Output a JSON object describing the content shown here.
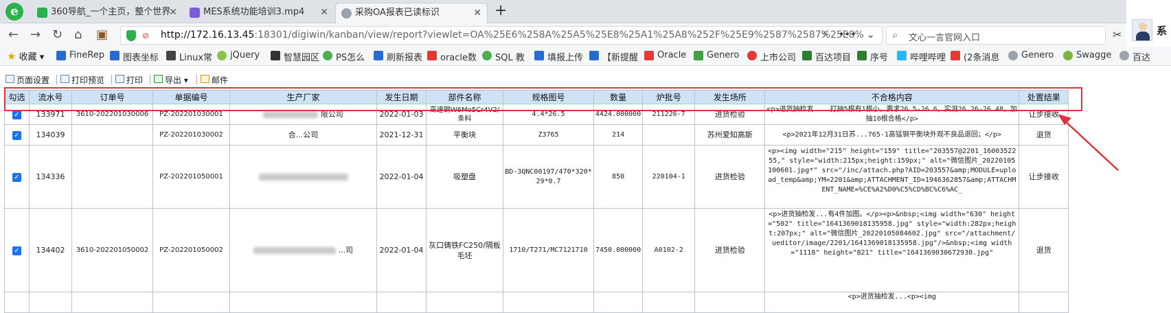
{
  "browser": {
    "tabs": [
      {
        "title": "360导航_一个主页，整个世界"
      },
      {
        "title": "MES系统功能培训3.mp4"
      },
      {
        "title": "采购OA报表已读标识"
      }
    ],
    "user_name": "系"
  },
  "address": {
    "url_host": "http://172.16.13.45",
    "url_rest": ":18301/digiwin/kanban/view/report?viewlet=OA%25E6%258A%25A5%25E8%25A1%25A8%252F%25E9%2587%2587%25E8%",
    "search_text": "文心一言官网入口"
  },
  "bookmarks": [
    {
      "label": "收藏"
    },
    {
      "label": "FineRep"
    },
    {
      "label": "图表坐标"
    },
    {
      "label": "Linux常"
    },
    {
      "label": "jQuery"
    },
    {
      "label": "智慧园区"
    },
    {
      "label": "PS怎么"
    },
    {
      "label": "刷新报表"
    },
    {
      "label": "oracle数"
    },
    {
      "label": "SQL 教"
    },
    {
      "label": "填报上传"
    },
    {
      "label": "【新提醒"
    },
    {
      "label": "Oracle"
    },
    {
      "label": "Genero"
    },
    {
      "label": "上市公司"
    },
    {
      "label": "百达项目"
    },
    {
      "label": "序号"
    },
    {
      "label": "哔哩哔哩"
    },
    {
      "label": "(2条消息"
    },
    {
      "label": "Genero"
    },
    {
      "label": "Swagge"
    },
    {
      "label": "百达"
    }
  ],
  "toolbar": {
    "page_setup": "页面设置",
    "print_preview": "打印预览",
    "print": "打印",
    "export": "导出",
    "mail": "邮件"
  },
  "table": {
    "headers": [
      "勾选",
      "流水号",
      "订单号",
      "单据编号",
      "生产厂家",
      "发生日期",
      "部件名称",
      "规格图号",
      "数量",
      "炉批号",
      "发生场所",
      "不合格内容",
      "处置结果"
    ],
    "rows": [
      {
        "serial": "133971",
        "order": "3610-202201030006",
        "doc": "PZ-202201030001",
        "vendor": "限公司",
        "date": "2022-01-03",
        "part": "高速钢W6Mo5Cr4V2/条料",
        "spec": "4.4*26.5",
        "qty": "4424.000000",
        "batch": "211226-7",
        "place": "进货检验",
        "content": "<p>进货抽检发... 打抽5根有1根小，要求26.5-26.6，实测26.26-26.48，加抽10根合格</p>",
        "result": "让步接收"
      },
      {
        "serial": "134039",
        "order": "",
        "doc": "PZ-202201030002",
        "vendor": "合...公司",
        "date": "2021-12-31",
        "part": "平衡块",
        "spec": "Z3765",
        "qty": "214",
        "batch": "",
        "place": "苏州爱知高斯",
        "content": "<p>2021年12月31日苏...765-1高锰钢平衡块外观不良品退回；</p>",
        "result": "退货"
      },
      {
        "serial": "134336",
        "order": "",
        "doc": "PZ-202201050001",
        "vendor": "",
        "date": "2022-01-04",
        "part": "吸塑盘",
        "spec": "BD-3QNC00197/470*320*29*0.7",
        "qty": "850",
        "batch": "220104-1",
        "place": "进货检验",
        "content": "<p><img width=\"215\" height=\"159\" title=\"203557@2201_1600352255,\" style=\"width:215px;height:159px;\" alt=\"微信图片_20220105100601.jpg*\" src=\"/inc/attach.php?AID=203557&amp;MODULE=upload_temp&amp;YM=2201&amp;ATTACHMENT_ID=1946362857&amp;ATTACHMENT_NAME=%CE%A2%D0%C5%CD%BC%C6%AC_",
        "result": "让步接收"
      },
      {
        "serial": "134402",
        "order": "3610-202201050002",
        "doc": "PZ-202201050002",
        "vendor": "...司",
        "date": "2022-01-04",
        "part": "灰口铸铁FC250/隔板毛坯",
        "spec": "1710/T271/MC7121710",
        "qty": "7450.000000",
        "batch": "A0102-2",
        "place": "进货检验",
        "content": "<p>进货抽检发...有4件加图。</p><p>&nbsp;<img width=\"630\" height=\"502\" title=\"1641369018135958.jpg\" style=\"width:282px;height:207px;\" alt=\"微信图片_20220105084602.jpg\" src=\"/attachment/ueditor/image/2201/1641369018135958.jpg\"/>&nbsp;<img width=\"1118\" height=\"821\" title=\"1641369030672930.jpg\"",
        "result": "退货"
      },
      {
        "serial": "",
        "order": "",
        "doc": "",
        "vendor": "",
        "date": "",
        "part": "",
        "spec": "",
        "qty": "",
        "batch": "",
        "place": "",
        "content": "<p>进货抽检发...<p><img",
        "result": ""
      }
    ]
  }
}
